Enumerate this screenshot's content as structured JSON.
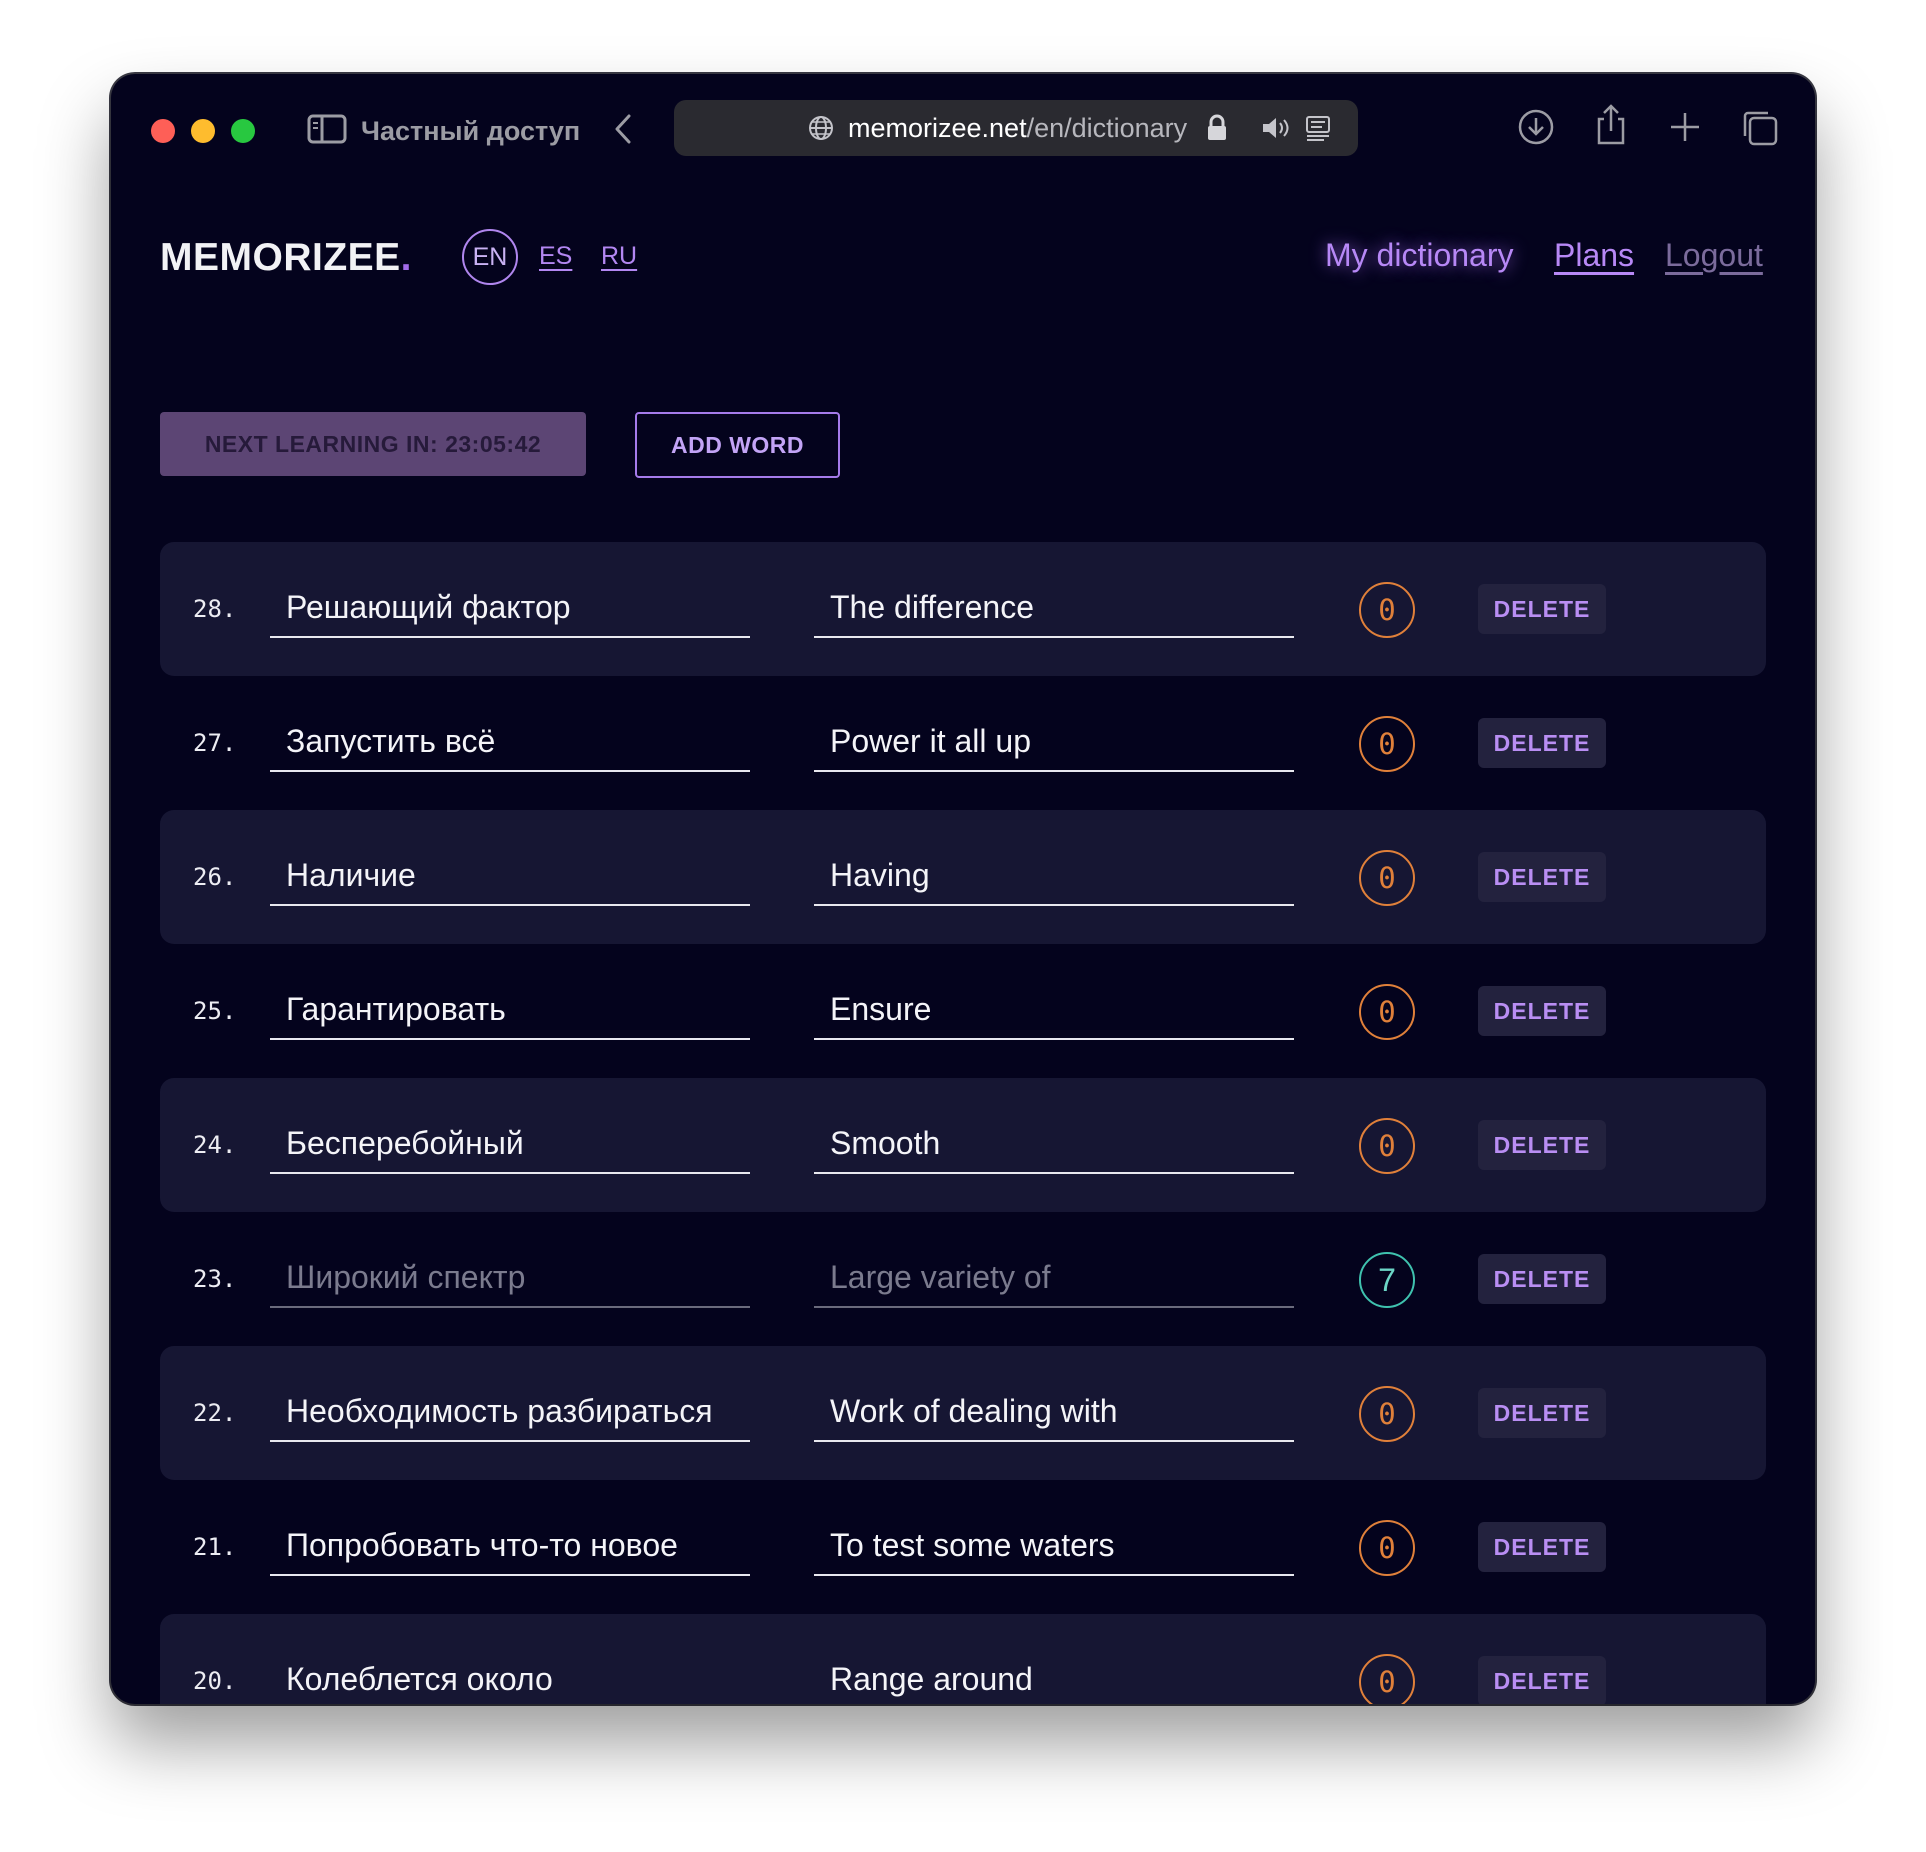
{
  "browser": {
    "private_label": "Частный доступ",
    "url_host": "memorizee.net",
    "url_path": "/en/dictionary"
  },
  "site": {
    "logo_text": "MEMORIZEE",
    "logo_dot": ".",
    "languages": {
      "current": "EN",
      "es": "ES",
      "ru": "RU"
    },
    "nav": {
      "dictionary": "My dictionary",
      "plans": "Plans",
      "logout": "Logout"
    }
  },
  "actions": {
    "next_learning": "NEXT LEARNING IN: 23:05:42",
    "add_word": "ADD WORD"
  },
  "words": [
    {
      "num": "28.",
      "ru": "Решающий фактор",
      "en": "The difference",
      "score": "0",
      "delete": "DELETE"
    },
    {
      "num": "27.",
      "ru": "Запустить всё",
      "en": "Power it all up",
      "score": "0",
      "delete": "DELETE"
    },
    {
      "num": "26.",
      "ru": "Наличие",
      "en": "Having",
      "score": "0",
      "delete": "DELETE"
    },
    {
      "num": "25.",
      "ru": "Гарантировать",
      "en": "Ensure",
      "score": "0",
      "delete": "DELETE"
    },
    {
      "num": "24.",
      "ru": "Бесперебойный",
      "en": "Smooth",
      "score": "0",
      "delete": "DELETE"
    },
    {
      "num": "23.",
      "ru": "Широкий спектр",
      "en": "Large variety of",
      "score": "7",
      "delete": "DELETE"
    },
    {
      "num": "22.",
      "ru": "Необходимость разбираться",
      "en": "Work of dealing with",
      "score": "0",
      "delete": "DELETE"
    },
    {
      "num": "21.",
      "ru": "Попробовать что-то новое",
      "en": "To test some waters",
      "score": "0",
      "delete": "DELETE"
    },
    {
      "num": "20.",
      "ru": "Колеблется около",
      "en": "Range around",
      "score": "0",
      "delete": "DELETE"
    }
  ],
  "colors": {
    "background": "#04031d",
    "row_alt": "#161633",
    "accent": "#b788f6",
    "score_zero": "#e0803a",
    "score_learned": "#3fc2ae"
  }
}
